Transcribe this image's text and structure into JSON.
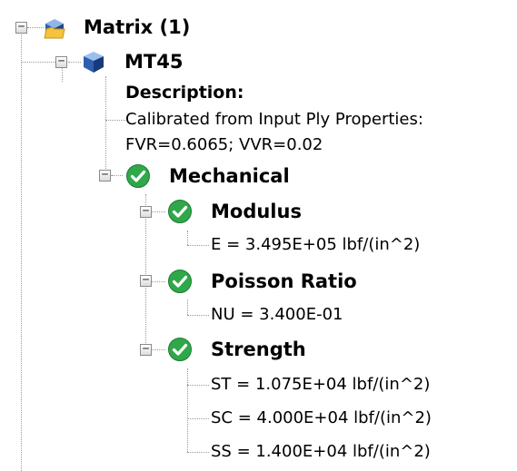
{
  "tree": {
    "matrix": {
      "label": "Matrix (1)",
      "icon": "folder-cube-icon",
      "expander": "−"
    },
    "material": {
      "label": "MT45",
      "icon": "material-cube-icon",
      "expander": "−",
      "description": {
        "heading": "Description:",
        "line1": "Calibrated from Input Ply Properties:",
        "line2": "FVR=0.6065; VVR=0.02"
      }
    },
    "mechanical": {
      "label": "Mechanical",
      "icon": "green-check-icon",
      "expander": "−"
    },
    "modulus": {
      "label": "Modulus",
      "icon": "green-check-icon",
      "expander": "−",
      "values": [
        "E = 3.495E+05 lbf/(in^2)"
      ]
    },
    "poisson": {
      "label": "Poisson Ratio",
      "icon": "green-check-icon",
      "expander": "−",
      "values": [
        "NU = 3.400E-01"
      ]
    },
    "strength": {
      "label": "Strength",
      "icon": "green-check-icon",
      "expander": "−",
      "values": [
        "ST = 1.075E+04 lbf/(in^2)",
        "SC = 4.000E+04 lbf/(in^2)",
        "SS = 1.400E+04 lbf/(in^2)"
      ]
    }
  },
  "colors": {
    "check_green": "#2fa84a",
    "folder_yellow": "#f3c43c",
    "cube_blue": "#2d5fb0",
    "guide_gray": "#9a9a9a"
  }
}
